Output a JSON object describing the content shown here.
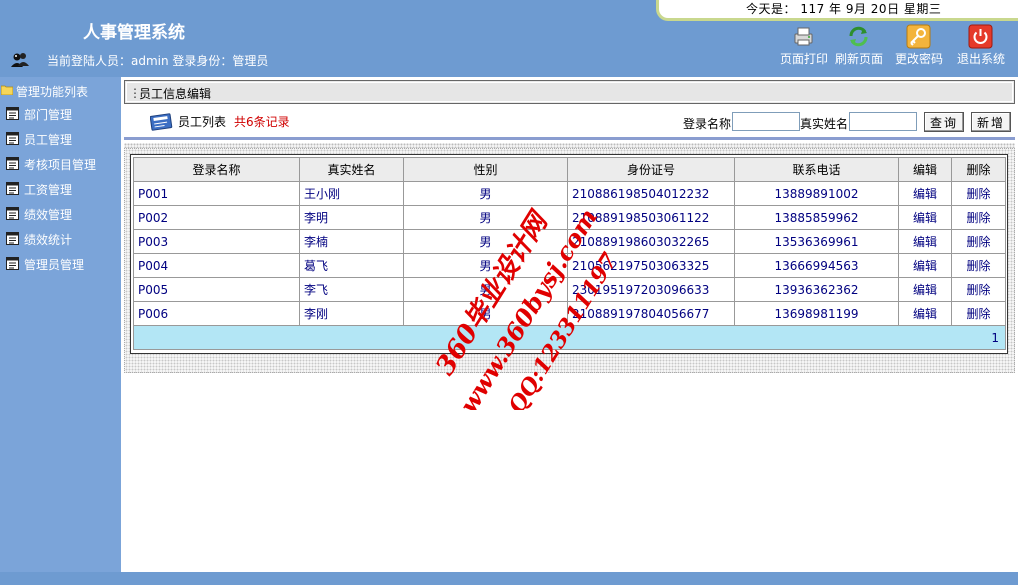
{
  "app": {
    "title": "人事管理系统",
    "login_info": "当前登陆人员：admin 登录身份：管理员",
    "date": "今天是： 117 年 9月 20日 星期三"
  },
  "toolbar": {
    "print": "页面打印",
    "refresh": "刷新页面",
    "password": "更改密码",
    "logout": "退出系统"
  },
  "sidebar": {
    "title": "管理功能列表",
    "items": [
      {
        "label": "部门管理"
      },
      {
        "label": "员工管理"
      },
      {
        "label": "考核项目管理"
      },
      {
        "label": "工资管理"
      },
      {
        "label": "绩效管理"
      },
      {
        "label": "绩效统计"
      },
      {
        "label": "管理员管理"
      }
    ]
  },
  "main": {
    "section_title": "员工信息编辑",
    "list_label": "员工列表",
    "record_count": "共6条记录",
    "search": {
      "login_name_label": "登录名称",
      "real_name_label": "真实姓名",
      "login_name_value": "",
      "real_name_value": "",
      "query_button": "查询",
      "add_button": "新增"
    },
    "table": {
      "headers": [
        "登录名称",
        "真实姓名",
        "性别",
        "身份证号",
        "联系电话",
        "编辑",
        "删除"
      ],
      "rows": [
        {
          "login": "P001",
          "name": "王小刚",
          "gender": "男",
          "id": "210886198504012232",
          "phone": "13889891002",
          "edit": "编辑",
          "delete": "删除"
        },
        {
          "login": "P002",
          "name": "李明",
          "gender": "男",
          "id": "210889198503061122",
          "phone": "13885859962",
          "edit": "编辑",
          "delete": "删除"
        },
        {
          "login": "P003",
          "name": "李楠",
          "gender": "男",
          "id": "210889198603032265",
          "phone": "13536369961",
          "edit": "编辑",
          "delete": "删除"
        },
        {
          "login": "P004",
          "name": "葛飞",
          "gender": "男",
          "id": "210562197503063325",
          "phone": "13666994563",
          "edit": "编辑",
          "delete": "删除"
        },
        {
          "login": "P005",
          "name": "李飞",
          "gender": "男",
          "id": "230195197203096633",
          "phone": "13936362362",
          "edit": "编辑",
          "delete": "删除"
        },
        {
          "login": "P006",
          "name": "李刚",
          "gender": "男",
          "id": "210889197804056677",
          "phone": "13698981199",
          "edit": "编辑",
          "delete": "删除"
        }
      ],
      "page": "1"
    }
  },
  "watermark": {
    "line1": "360毕业设计网",
    "line2": "www.360bysj.com",
    "line3": "QQ:123311197"
  },
  "colors": {
    "header_bg": "#6e9bd1",
    "sidebar_bg": "#7ba4d9",
    "link": "#000080",
    "record_count": "#d00000",
    "pager_bg": "#b3e6f5",
    "watermark": "#e00000"
  }
}
